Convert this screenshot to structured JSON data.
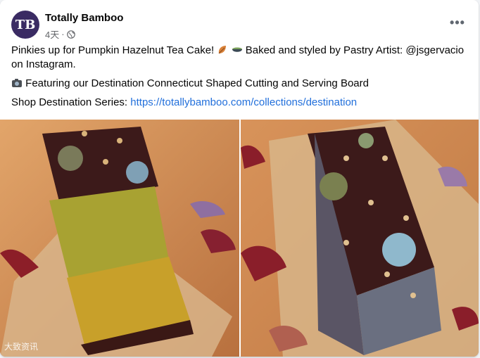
{
  "post": {
    "page_name": "Totally Bamboo",
    "avatar_text": "TB",
    "timestamp": "4天",
    "separator": "·",
    "privacy_icon": "globe-icon",
    "more_icon": "more-options-icon",
    "line1": "Pinkies up for Pumpkin Hazelnut Tea Cake!",
    "line1_emojis": [
      "fallen-leaf-emoji",
      "bowl-emoji"
    ],
    "line1_rest": "Baked and styled by Pastry Artist: @jsgervacio on Instagram.",
    "line2_emoji": "camera-emoji",
    "line2": "Featuring our Destination Connecticut Shaped Cutting and Serving Board",
    "line3_prefix": "Shop Destination Series:",
    "line3_link": "https://totallybamboo.com/collections/destination"
  },
  "photos": {
    "left_alt": "Sliced pumpkin hazelnut tea cake with chocolate frosting on a bamboo cutting board",
    "right_alt": "Whole pumpkin hazelnut tea cake with chocolate frosting and gold pearls",
    "watermark": "大致资讯"
  },
  "colors": {
    "link": "#216fdb",
    "secondary_text": "#65676b",
    "avatar_bg": "#3a2b63"
  }
}
